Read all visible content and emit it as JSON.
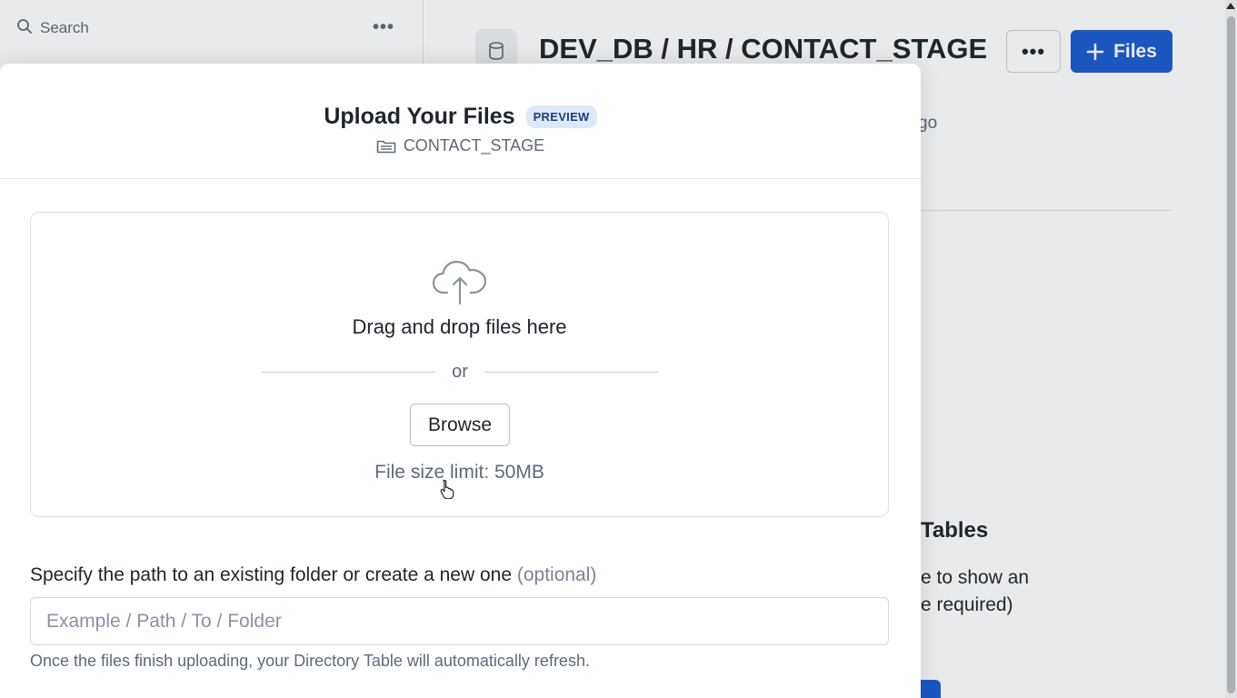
{
  "sidebar": {
    "search_label": "Search",
    "more_icon": "more-horizontal-icon"
  },
  "header": {
    "breadcrumb": [
      "DEV_DB",
      "HR",
      "CONTACT_STAGE"
    ],
    "separator": " / ",
    "more_icon": "more-horizontal-icon",
    "files_button_label": "Files"
  },
  "background": {
    "time_fragment": "go",
    "section_title_fragment": "Tables",
    "body_line1_fragment": "e to show an",
    "body_line2_fragment": "e required)"
  },
  "modal": {
    "title": "Upload Your Files",
    "badge": "PREVIEW",
    "stage_name": "CONTACT_STAGE",
    "dropzone": {
      "drag_text": "Drag and drop files here",
      "or_text": "or",
      "browse_label": "Browse",
      "size_limit": "File size limit: 50MB"
    },
    "path": {
      "label": "Specify the path to an existing folder or create a new one",
      "optional": "(optional)",
      "placeholder": "Example / Path / To / Folder",
      "value": "",
      "help_text": "Once the files finish uploading, your Directory Table will automatically refresh."
    }
  },
  "colors": {
    "accent": "#1a5bd1",
    "badge_bg": "#dde8fb",
    "text": "#1e252d",
    "muted": "#5d6a7a"
  }
}
